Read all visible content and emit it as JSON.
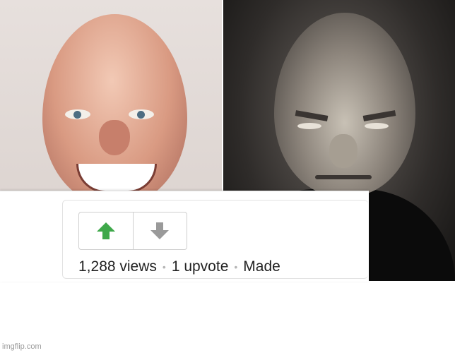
{
  "vote": {
    "upvote_icon": "up-arrow-icon",
    "downvote_icon": "down-arrow-icon",
    "upvote_color": "#3ea84a",
    "downvote_color": "#9a9a9a"
  },
  "stats": {
    "views": "1,288 views",
    "upvotes": "1 upvote",
    "made_by": "Made",
    "separator": "•"
  },
  "watermark": "imgflip.com"
}
